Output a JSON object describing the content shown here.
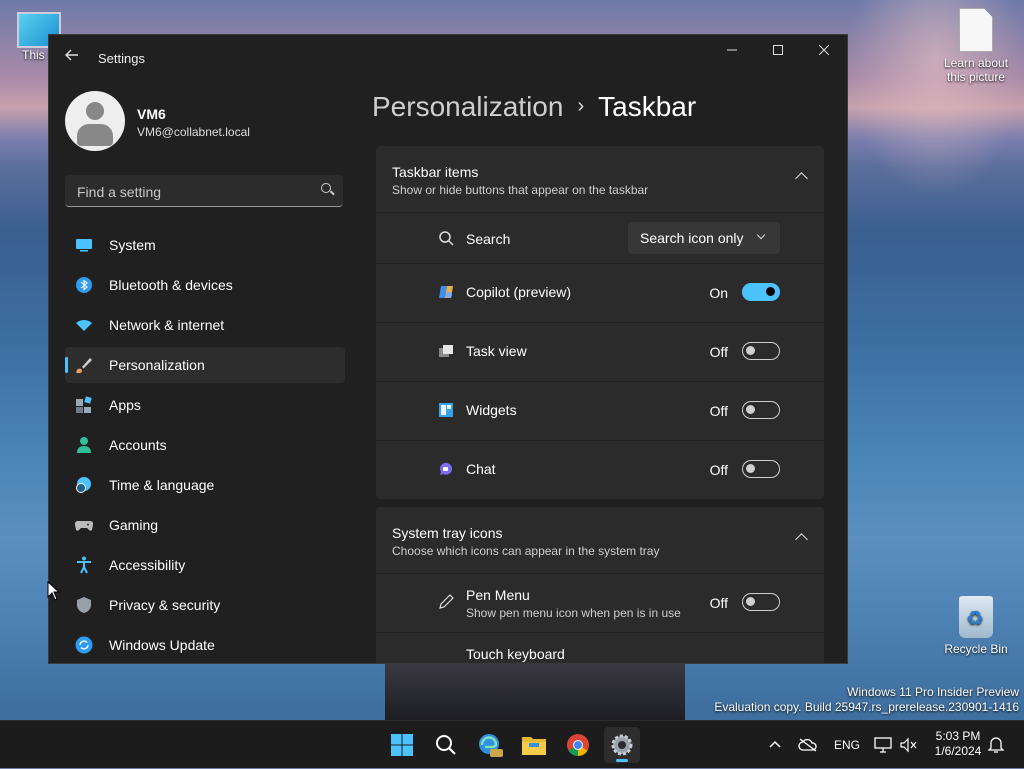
{
  "desktop": {
    "this_pc_label": "This P",
    "learn_label": "Learn about this picture",
    "recycle_bin_label": "Recycle Bin",
    "watermark_line1": "Windows 11 Pro Insider Preview",
    "watermark_line2": "Evaluation copy. Build 25947.rs_prerelease.230901-1416"
  },
  "window": {
    "title": "Settings",
    "controls": {
      "minimize": "—",
      "maximize": "☐",
      "close": "✕"
    }
  },
  "profile": {
    "name": "VM6",
    "email": "VM6@collabnet.local"
  },
  "search": {
    "placeholder": "Find a setting"
  },
  "nav": {
    "items": [
      {
        "label": "System",
        "icon": "system-icon",
        "color": "#4cc2ff"
      },
      {
        "label": "Bluetooth & devices",
        "icon": "bluetooth-icon",
        "color": "#2f9bf0"
      },
      {
        "label": "Network & internet",
        "icon": "wifi-icon",
        "color": "#4cc2ff"
      },
      {
        "label": "Personalization",
        "icon": "brush-icon",
        "color": "#e8a060",
        "active": true
      },
      {
        "label": "Apps",
        "icon": "apps-icon",
        "color": "#9aa7b4"
      },
      {
        "label": "Accounts",
        "icon": "person-icon",
        "color": "#2fc09a"
      },
      {
        "label": "Time & language",
        "icon": "globe-clock-icon",
        "color": "#4cc2ff"
      },
      {
        "label": "Gaming",
        "icon": "gamepad-icon",
        "color": "#bbbbbb"
      },
      {
        "label": "Accessibility",
        "icon": "accessibility-icon",
        "color": "#4cc2ff"
      },
      {
        "label": "Privacy & security",
        "icon": "shield-icon",
        "color": "#9aa0a8"
      },
      {
        "label": "Windows Update",
        "icon": "update-icon",
        "color": "#2f9bf0"
      }
    ]
  },
  "breadcrumb": {
    "parent": "Personalization",
    "separator": "›",
    "current": "Taskbar"
  },
  "taskbar_items": {
    "title": "Taskbar items",
    "subtitle": "Show or hide buttons that appear on the taskbar",
    "search": {
      "label": "Search",
      "value": "Search icon only"
    },
    "rows": [
      {
        "label": "Copilot (preview)",
        "state": "On",
        "on": true,
        "icon": "copilot-icon"
      },
      {
        "label": "Task view",
        "state": "Off",
        "on": false,
        "icon": "task-view-icon"
      },
      {
        "label": "Widgets",
        "state": "Off",
        "on": false,
        "icon": "widgets-icon"
      },
      {
        "label": "Chat",
        "state": "Off",
        "on": false,
        "icon": "chat-icon"
      }
    ]
  },
  "system_tray": {
    "title": "System tray icons",
    "subtitle": "Choose which icons can appear in the system tray",
    "pen_menu": {
      "label": "Pen Menu",
      "sub": "Show pen menu icon when pen is in use",
      "state": "Off"
    },
    "touch_keyboard": {
      "label": "Touch keyboard"
    }
  },
  "taskbar": {
    "apps": [
      "start-icon",
      "search-icon",
      "edge-beta-icon",
      "file-explorer-icon",
      "chrome-icon",
      "settings-icon"
    ],
    "language": "ENG",
    "time": "5:03 PM",
    "date": "1/6/2024"
  },
  "colors": {
    "accent": "#4cc2ff",
    "window_bg": "#202020",
    "card_bg": "#2b2b2b"
  }
}
